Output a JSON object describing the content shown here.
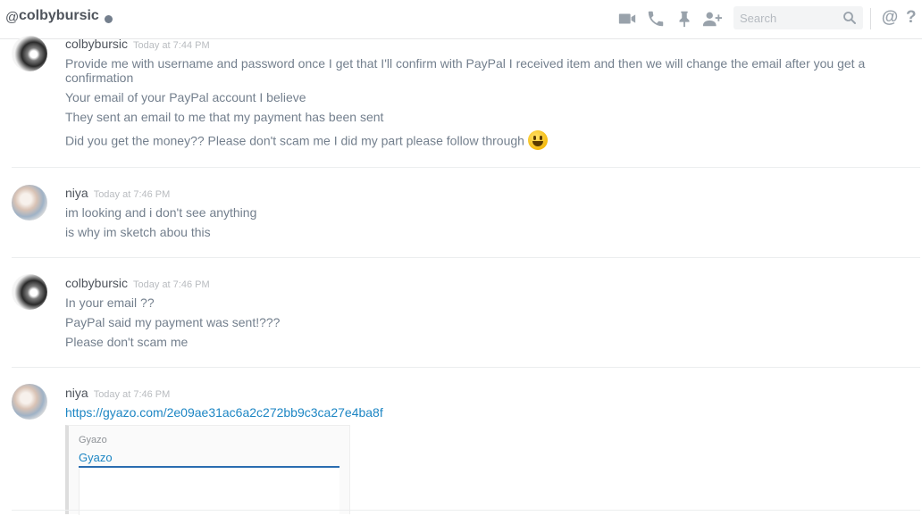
{
  "header": {
    "at_symbol": "@",
    "channel_name": "colbybursic",
    "search_placeholder": "Search",
    "mention_symbol": "@",
    "help_symbol": "?",
    "icons": [
      "video-call-icon",
      "voice-call-icon",
      "pin-icon",
      "add-friend-icon",
      "search-icon"
    ]
  },
  "messages": [
    {
      "author": "colbybursic",
      "timestamp": "Today at 7:44 PM",
      "lines": [
        "Provide me with username and password once I get that I'll confirm with PayPal I received item and then we will change the email after you get a confirmation",
        "Your email of your PayPal account I believe",
        "They sent an email to me that my payment has been sent",
        "Did you get the money?? Please don't scam me I did my part please follow through"
      ],
      "emoji": "smiley"
    },
    {
      "author": "niya",
      "timestamp": "Today at 7:46 PM",
      "lines": [
        "im looking and i don't see anything",
        "is why im sketch abou this"
      ]
    },
    {
      "author": "colbybursic",
      "timestamp": "Today at 7:46 PM",
      "lines": [
        "In your email ??",
        "PayPal said my payment was sent!???",
        "Please don't scam me"
      ]
    },
    {
      "author": "niya",
      "timestamp": "Today at 7:46 PM",
      "link": "https://gyazo.com/2e09ae31ac6a2c272bb9c3ca27e4ba8f",
      "embed": {
        "provider": "Gyazo",
        "title": "Gyazo"
      }
    }
  ],
  "colors": {
    "link": "#1d86c4",
    "text": "#737f8d",
    "username": "#4f545c",
    "timestamp": "#b9bcc0"
  }
}
